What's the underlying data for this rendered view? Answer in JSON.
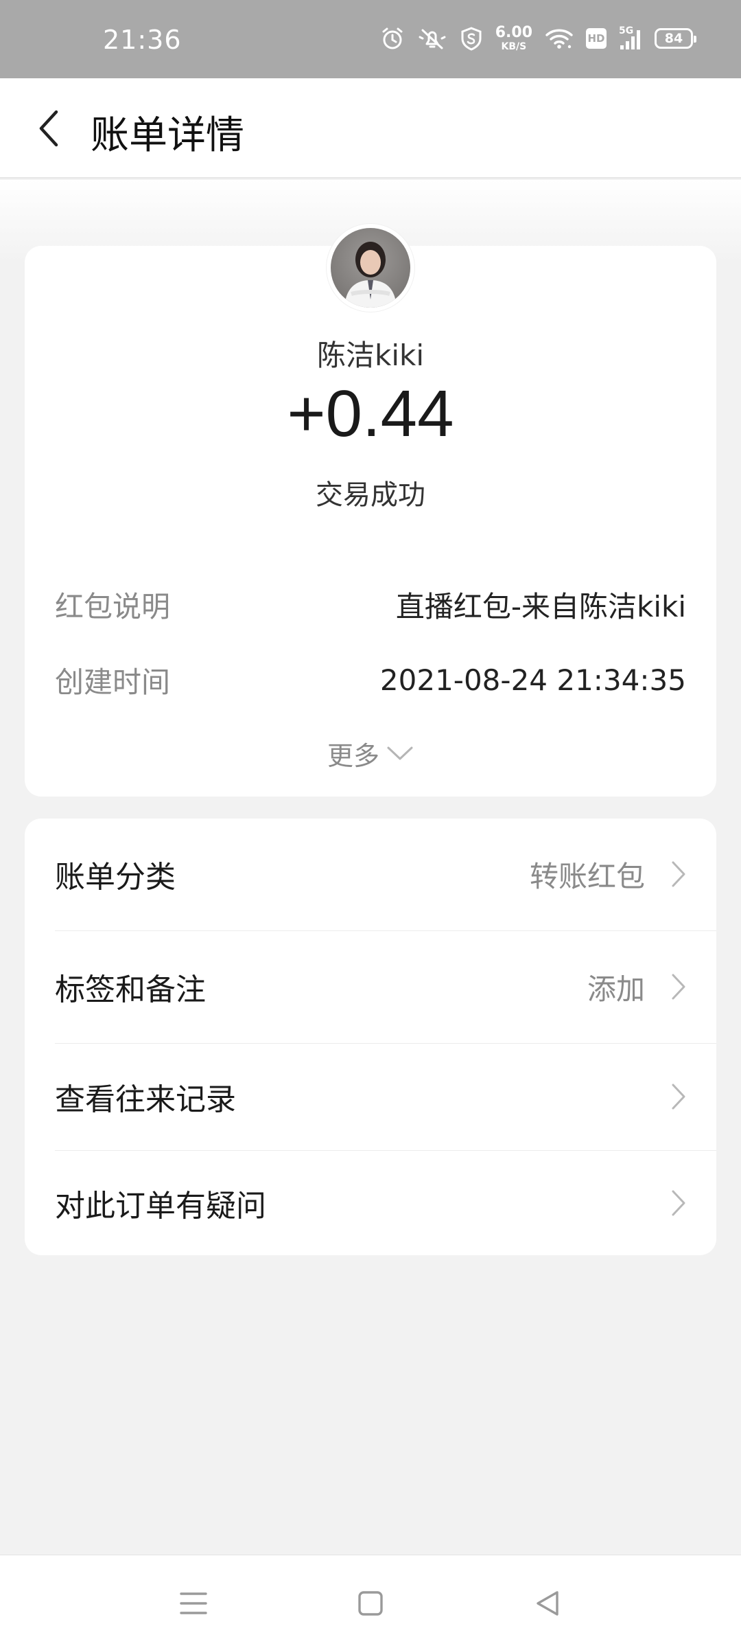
{
  "status_bar": {
    "time": "21:36",
    "speed_value": "6.00",
    "speed_unit": "KB/S",
    "hd_label": "HD",
    "network_label": "5G",
    "battery_level": "84",
    "icons": [
      "alarm-icon",
      "mute-icon",
      "shield-s-icon",
      "wifi-icon",
      "hd-icon",
      "signal-5g-icon",
      "battery-icon"
    ]
  },
  "header": {
    "title": "账单详情"
  },
  "bill": {
    "payer_name": "陈洁kiki",
    "amount": "+0.44",
    "status": "交易成功",
    "details": [
      {
        "label": "红包说明",
        "value": "直播红包-来自陈洁kiki"
      },
      {
        "label": "创建时间",
        "value": "2021-08-24 21:34:35"
      }
    ],
    "more_label": "更多"
  },
  "list": {
    "items": [
      {
        "label": "账单分类",
        "value": "转账红包"
      },
      {
        "label": "标签和备注",
        "value": "添加"
      },
      {
        "label": "查看往来记录",
        "value": ""
      },
      {
        "label": "对此订单有疑问",
        "value": ""
      }
    ]
  },
  "colors": {
    "status_bar_bg": "#a9a9a9",
    "page_bg": "#f2f2f2",
    "card_bg": "#ffffff",
    "muted_text": "#8a8a8a"
  }
}
